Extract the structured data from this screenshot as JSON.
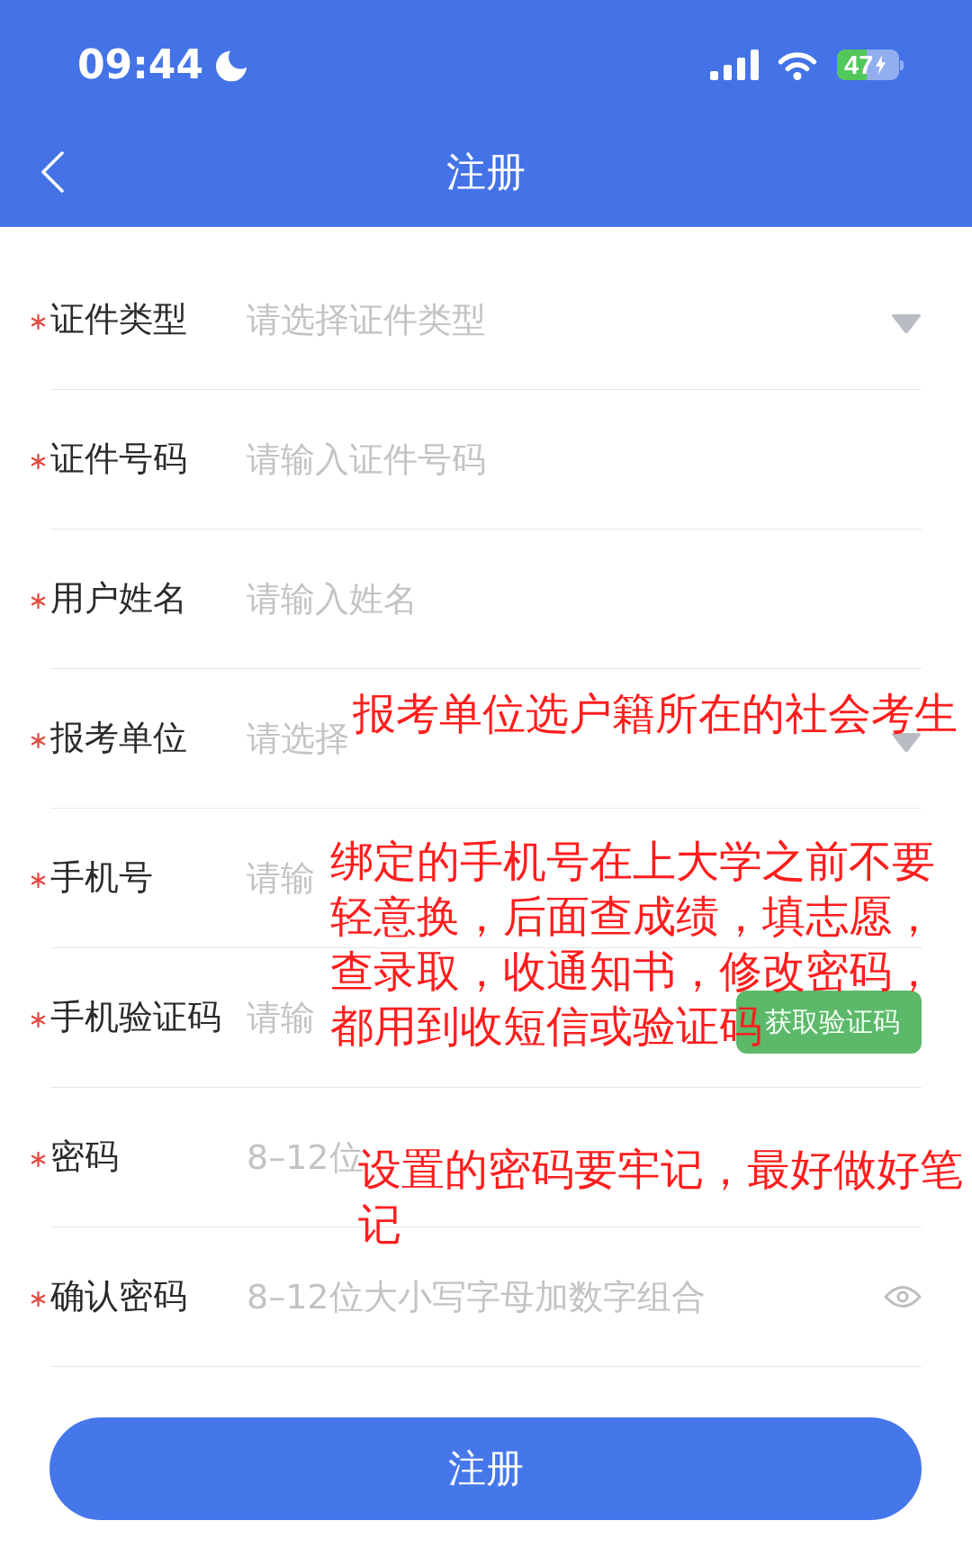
{
  "status_bar": {
    "time": "09:44",
    "battery": "47"
  },
  "nav_bar": {
    "title": "注册"
  },
  "fields": [
    {
      "kind": "select",
      "required": true,
      "label": "证件类型",
      "placeholder": "请选择证件类型"
    },
    {
      "kind": "input",
      "required": true,
      "label": "证件号码",
      "placeholder": "请输入证件号码"
    },
    {
      "kind": "input",
      "required": true,
      "label": "用户姓名",
      "placeholder": "请输入姓名"
    },
    {
      "kind": "select",
      "required": true,
      "label": "报考单位",
      "placeholder": "请选择"
    },
    {
      "kind": "input",
      "required": true,
      "label": "手机号",
      "placeholder": "请输"
    },
    {
      "kind": "code",
      "required": true,
      "label": "手机验证码",
      "placeholder": "请输",
      "button": "获取验证码"
    },
    {
      "kind": "password",
      "required": true,
      "label": "密码",
      "placeholder": "8–12位"
    },
    {
      "kind": "password",
      "required": true,
      "label": "确认密码",
      "placeholder": "8–12位大小写字母加数字组合",
      "show_toggle": true
    }
  ],
  "submit_button": "注册",
  "annotations": [
    {
      "lines": [
        "报考单位选户籍所在的社会考生"
      ]
    },
    {
      "lines": [
        "绑定的手机号在上大学之前不要",
        "轻意换，后面查成绩，填志愿，",
        "查录取，收通知书，修改密码，",
        "都用到收短信或验证码"
      ]
    },
    {
      "lines": [
        "设置的密码要牢记，最好做好笔",
        "记"
      ]
    }
  ]
}
